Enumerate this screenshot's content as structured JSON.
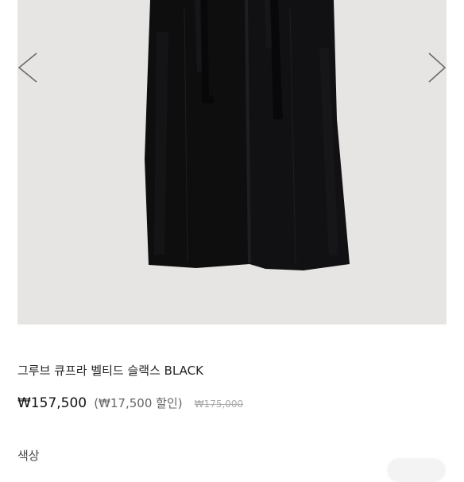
{
  "gallery": {
    "image_alt": "black pants",
    "prev_icon": "chevron-left-icon",
    "next_icon": "chevron-right-icon",
    "bg_color": "#e6e5e3"
  },
  "product": {
    "name": "그루브 큐프라 벨티드 슬랙스 BLACK",
    "sale_price": "₩157,500",
    "discount": "(₩17,500 할인)",
    "original_price": "₩175,000"
  },
  "options": {
    "color_label": "색상"
  }
}
